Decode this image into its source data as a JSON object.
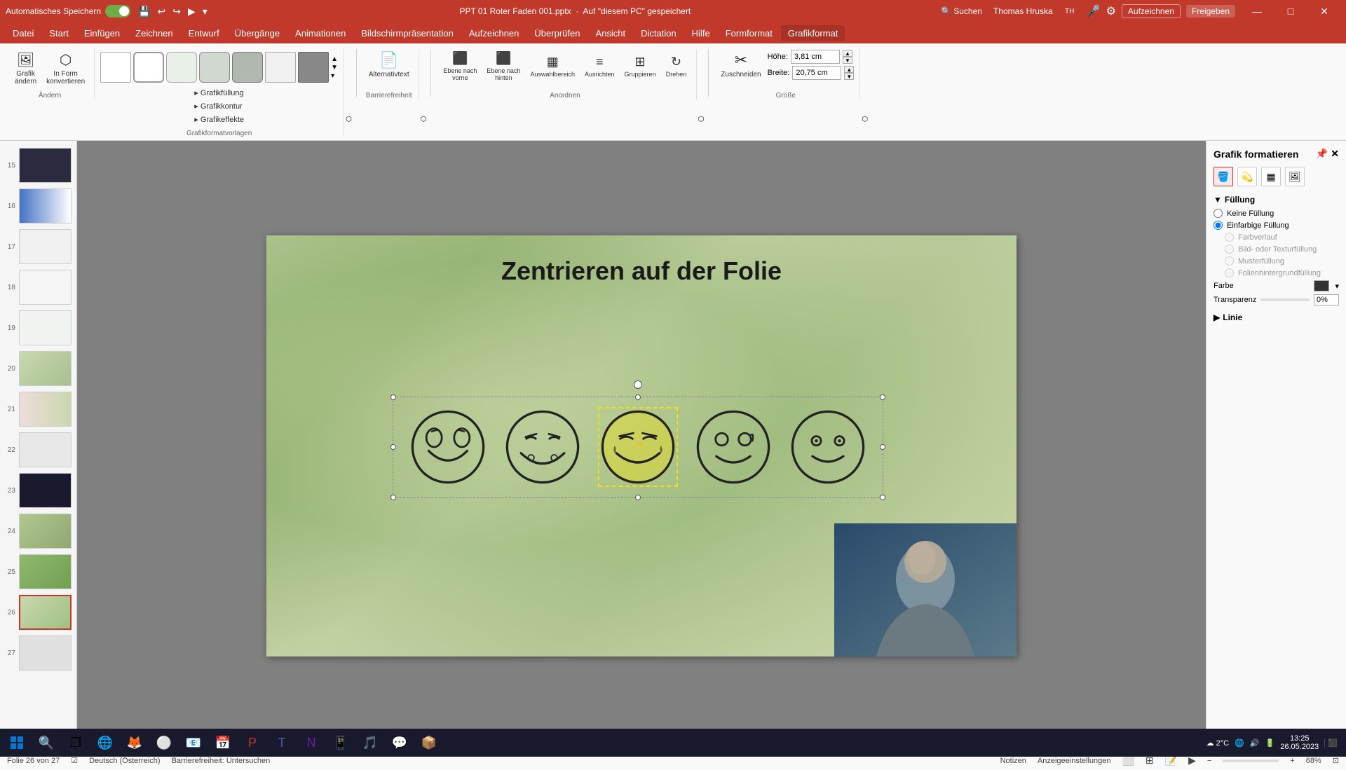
{
  "titlebar": {
    "autosave_label": "Automatisches Speichern",
    "file_name": "PPT 01 Roter Faden 001.pptx",
    "saved_location": "Auf \"diesem PC\" gespeichert",
    "user_name": "Thomas Hruska",
    "user_initials": "TH",
    "window_controls": {
      "minimize": "—",
      "maximize": "□",
      "close": "✕"
    }
  },
  "menubar": {
    "items": [
      {
        "id": "datei",
        "label": "Datei"
      },
      {
        "id": "start",
        "label": "Start"
      },
      {
        "id": "einfuegen",
        "label": "Einfügen"
      },
      {
        "id": "zeichnen",
        "label": "Zeichnen"
      },
      {
        "id": "entwurf",
        "label": "Entwurf"
      },
      {
        "id": "uebergaenge",
        "label": "Übergänge"
      },
      {
        "id": "animationen",
        "label": "Animationen"
      },
      {
        "id": "bildschirmpraesentaion",
        "label": "Bildschirmpräsentation"
      },
      {
        "id": "aufzeichnen",
        "label": "Aufzeichnen"
      },
      {
        "id": "ueberpruefen",
        "label": "Überprüfen"
      },
      {
        "id": "ansicht",
        "label": "Ansicht"
      },
      {
        "id": "dictation",
        "label": "Dictation"
      },
      {
        "id": "hilfe",
        "label": "Hilfe"
      },
      {
        "id": "formformat",
        "label": "Formformat"
      },
      {
        "id": "grafikformat",
        "label": "Grafikformat"
      }
    ]
  },
  "ribbon": {
    "groups": {
      "aendern": {
        "label": "Ändern",
        "buttons": [
          {
            "id": "grafik-aendern",
            "label": "Grafik\nändern",
            "icon": "🖼"
          },
          {
            "id": "in-form-konvertieren",
            "label": "In Form\nkonvertieren",
            "icon": "⬡"
          }
        ]
      },
      "shapes": {
        "label": "Grafikformatvorlagen"
      },
      "barrierefreiheit": {
        "label": "Barrierefreiheit",
        "buttons": [
          {
            "id": "alternativtext",
            "label": "Alternativtext",
            "icon": "📄"
          },
          {
            "id": "ebene-vorne",
            "label": "Ebene nach\nvorne",
            "icon": "⬛"
          },
          {
            "id": "ebene-hinten",
            "label": "Ebene nach\nhinten",
            "icon": "⬛"
          },
          {
            "id": "auswahlbereich",
            "label": "Auswahlbereich",
            "icon": "⬛"
          },
          {
            "id": "ausrichten",
            "label": "Ausrichten",
            "icon": "⬛"
          },
          {
            "id": "gruppieren",
            "label": "Gruppieren",
            "icon": "⬛"
          },
          {
            "id": "drehen",
            "label": "Drehen",
            "icon": "↻"
          }
        ],
        "anordnen_label": "Anordnen"
      },
      "groesse": {
        "label": "Größe",
        "hoehe_label": "Höhe:",
        "hoehe_value": "3,81 cm",
        "breite_label": "Breite:",
        "breite_value": "20,75 cm",
        "zuschneiden_label": "Zuschneiden"
      }
    },
    "shape_styles": [
      {
        "id": "s1",
        "style": "plain-white"
      },
      {
        "id": "s2",
        "style": "rounded-white"
      },
      {
        "id": "s3",
        "style": "rounded-light"
      },
      {
        "id": "s4",
        "style": "rounded-medium"
      },
      {
        "id": "s5",
        "style": "rounded-dark"
      },
      {
        "id": "s6",
        "style": "plain-light"
      },
      {
        "id": "s7",
        "style": "plain-dark"
      }
    ],
    "grafik_dropdown_items": [
      {
        "label": "Grafikfüllung"
      },
      {
        "label": "Grafikkontur"
      },
      {
        "label": "Grafikeffekte"
      }
    ]
  },
  "slide": {
    "title": "Zentrieren auf der Folie",
    "number": "26",
    "total": "27"
  },
  "right_panel": {
    "title": "Grafik formatieren",
    "sections": {
      "fuellung": {
        "label": "Füllung",
        "options": [
          {
            "id": "keine-fuellung",
            "label": "Keine Füllung",
            "selected": false
          },
          {
            "id": "einfarbige-fuellung",
            "label": "Einfarbige Füllung",
            "selected": true
          },
          {
            "id": "farbverlauf",
            "label": "Farbverlauf",
            "selected": false,
            "disabled": true
          },
          {
            "id": "bild-textur",
            "label": "Bild- oder Texturfüllung",
            "selected": false,
            "disabled": true
          },
          {
            "id": "musterfuellung",
            "label": "Musterfüllung",
            "selected": false,
            "disabled": true
          },
          {
            "id": "folienhintergrund",
            "label": "Folienhintergrundfüllung",
            "selected": false,
            "disabled": true
          }
        ],
        "farbe_label": "Farbe",
        "transparenz_label": "Transparenz",
        "transparenz_value": "0%"
      },
      "linie": {
        "label": "Linie"
      }
    }
  },
  "statusbar": {
    "folie_label": "Folie 26 von 27",
    "sprache": "Deutsch (Österreich)",
    "barrierefreiheit": "Barrierefreiheit: Untersuchen",
    "notizen": "Notizen",
    "anzeigeeinstellungen": "Anzeigeeinstellungen"
  },
  "slides": [
    {
      "num": "15",
      "class": "slide15"
    },
    {
      "num": "16",
      "class": "slide16"
    },
    {
      "num": "17",
      "class": "slide17"
    },
    {
      "num": "18",
      "class": "slide18"
    },
    {
      "num": "19",
      "class": "slide19"
    },
    {
      "num": "20",
      "class": "slide20"
    },
    {
      "num": "21",
      "class": "slide21"
    },
    {
      "num": "22",
      "class": "slide22"
    },
    {
      "num": "23",
      "class": "slide23"
    },
    {
      "num": "24",
      "class": "slide24"
    },
    {
      "num": "25",
      "class": "slide25"
    },
    {
      "num": "26",
      "class": "slide26",
      "active": true
    },
    {
      "num": "27",
      "class": "slide27"
    }
  ],
  "taskbar": {
    "apps": [
      {
        "id": "start",
        "icon": "⊞"
      },
      {
        "id": "search",
        "icon": "🔍"
      },
      {
        "id": "taskview",
        "icon": "❐"
      },
      {
        "id": "edge",
        "icon": "🌐"
      },
      {
        "id": "firefox",
        "icon": "🦊"
      },
      {
        "id": "chrome",
        "icon": "⚪"
      },
      {
        "id": "mail",
        "icon": "📧"
      },
      {
        "id": "powerpoint",
        "icon": "📊"
      },
      {
        "id": "teams",
        "icon": "T"
      },
      {
        "id": "outlook",
        "icon": "📅"
      }
    ],
    "systray": {
      "weather": "2°C",
      "time": "13:25",
      "date": "26.05.2023"
    }
  }
}
